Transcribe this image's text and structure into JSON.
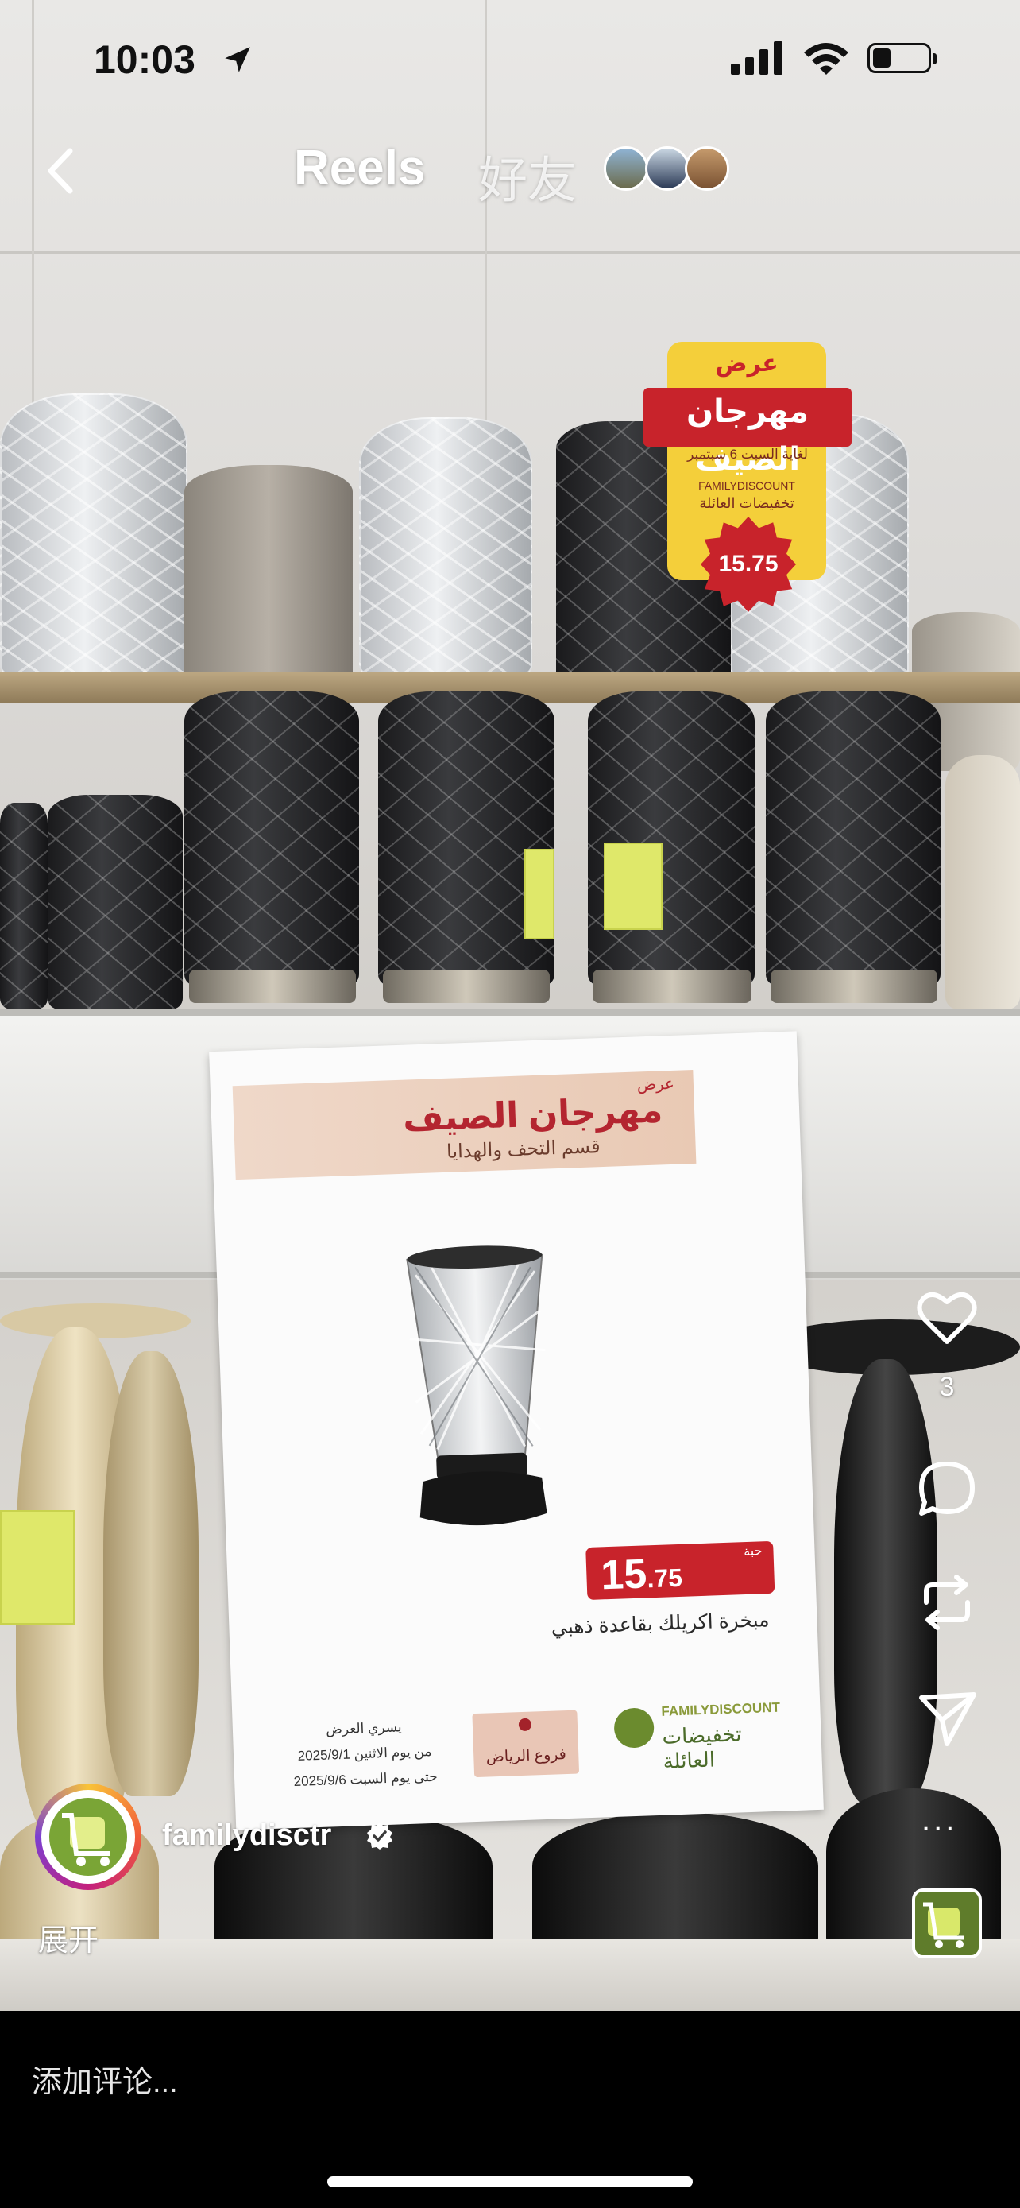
{
  "status_bar": {
    "time": "10:03"
  },
  "header": {
    "tab_reels": "Reels",
    "tab_friends": "好友"
  },
  "promo_badge": {
    "offer": "عرض",
    "title": "مهرجان الصيف",
    "until": "لغاية السبت 6 سبتمبر",
    "brand_en": "FAMILYDISCOUNT",
    "brand_ar": "تخفيضات العائلة",
    "price": "15.75"
  },
  "poster": {
    "offer": "عرض",
    "title": "مهرجان الصيف",
    "subtitle": "قسم التحف والهدايا",
    "price_unit": "حبة",
    "price_main": "15",
    "price_decimal": ".75",
    "product": "مبخرة اكريلك بقاعدة ذهبي",
    "brand_en": "FAMILYDISCOUNT",
    "brand_ar": "تخفيضات العائلة",
    "branch": "فروع الرياض",
    "validity_title": "يسري العرض",
    "date_from": "من يوم الاثنين 2025/9/1",
    "date_to": "حتى يوم السبت 2025/9/6"
  },
  "rail": {
    "like_count": "3",
    "more": "..."
  },
  "author": {
    "username": "familydisctr",
    "expand": "展开"
  },
  "comment": {
    "placeholder": "添加评论..."
  },
  "icons": [
    "back-chevron-icon",
    "heart-icon",
    "comment-icon",
    "repost-icon",
    "send-icon",
    "more-icon",
    "verified-icon",
    "location-arrow-icon",
    "signal-icon",
    "wifi-icon",
    "battery-icon"
  ],
  "colors": {
    "promo_red": "#c8232b",
    "promo_yellow": "#f4cf3a",
    "brand_green": "#6b8b2e"
  }
}
